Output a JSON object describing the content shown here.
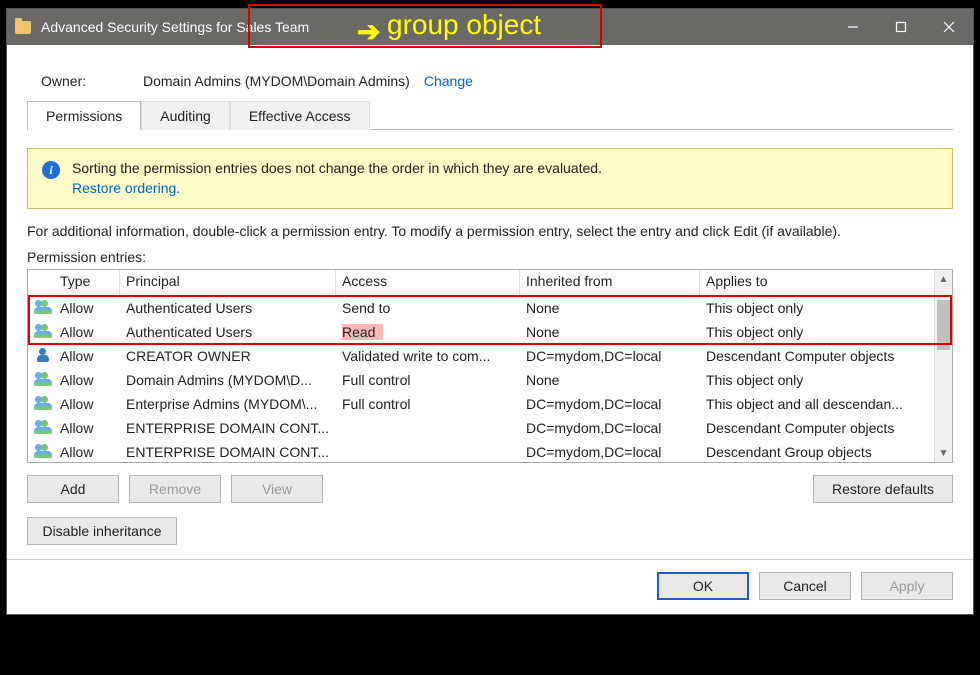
{
  "window": {
    "title": "Advanced Security Settings for Sales Team"
  },
  "annotation": {
    "arrow": "➔",
    "label": "group object"
  },
  "owner": {
    "label": "Owner:",
    "value": "Domain Admins (MYDOM\\Domain Admins)",
    "change": "Change"
  },
  "tabs": {
    "permissions": "Permissions",
    "auditing": "Auditing",
    "effective": "Effective Access"
  },
  "infobox": {
    "text": "Sorting the permission entries does not change the order in which they are evaluated.",
    "restore": "Restore ordering."
  },
  "para": "For additional information, double-click a permission entry. To modify a permission entry, select the entry and click Edit (if available).",
  "entries_label": "Permission entries:",
  "columns": {
    "type": "Type",
    "principal": "Principal",
    "access": "Access",
    "inherited": "Inherited from",
    "applies": "Applies to"
  },
  "rows": [
    {
      "icon": "group",
      "type": "Allow",
      "principal": "Authenticated Users",
      "access": "Send to",
      "inherited": "None",
      "applies": "This object only",
      "access_pink": false
    },
    {
      "icon": "group",
      "type": "Allow",
      "principal": "Authenticated Users",
      "access": "Read",
      "inherited": "None",
      "applies": "This object only",
      "access_pink": true
    },
    {
      "icon": "user",
      "type": "Allow",
      "principal": "CREATOR OWNER",
      "access": "Validated write to com...",
      "inherited": "DC=mydom,DC=local",
      "applies": "Descendant Computer objects",
      "access_pink": false
    },
    {
      "icon": "group",
      "type": "Allow",
      "principal": "Domain Admins (MYDOM\\D...",
      "access": "Full control",
      "inherited": "None",
      "applies": "This object only",
      "access_pink": false
    },
    {
      "icon": "group",
      "type": "Allow",
      "principal": "Enterprise Admins (MYDOM\\...",
      "access": "Full control",
      "inherited": "DC=mydom,DC=local",
      "applies": "This object and all descendan...",
      "access_pink": false
    },
    {
      "icon": "group",
      "type": "Allow",
      "principal": "ENTERPRISE DOMAIN CONT...",
      "access": "",
      "inherited": "DC=mydom,DC=local",
      "applies": "Descendant Computer objects",
      "access_pink": false
    },
    {
      "icon": "group",
      "type": "Allow",
      "principal": "ENTERPRISE DOMAIN CONT...",
      "access": "",
      "inherited": "DC=mydom,DC=local",
      "applies": "Descendant Group objects",
      "access_pink": false
    }
  ],
  "buttons": {
    "add": "Add",
    "remove": "Remove",
    "view": "View",
    "restore_defaults": "Restore defaults",
    "disable_inheritance": "Disable inheritance",
    "ok": "OK",
    "cancel": "Cancel",
    "apply": "Apply"
  }
}
